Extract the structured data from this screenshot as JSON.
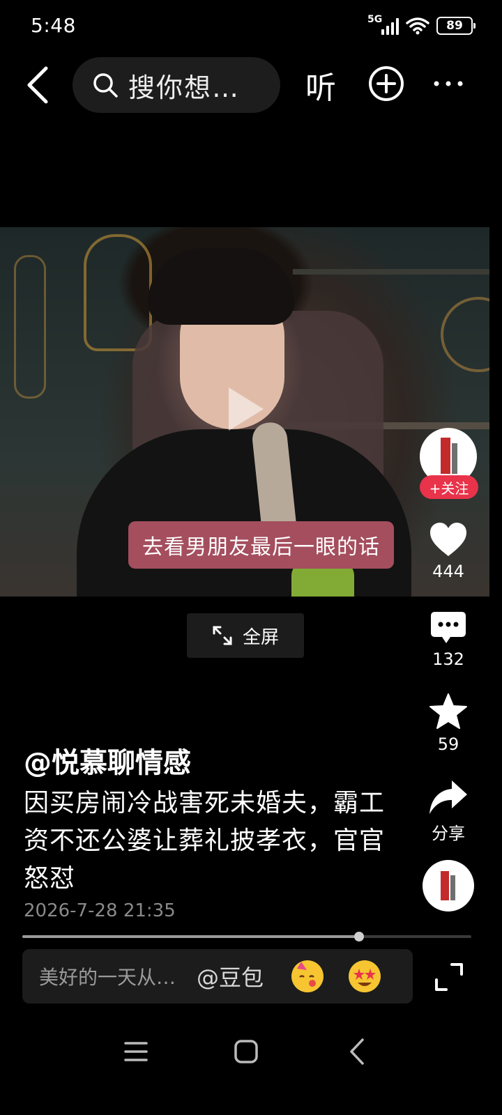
{
  "status_bar": {
    "time": "5:48",
    "network": "5G",
    "battery": "89"
  },
  "header": {
    "search_placeholder": "搜你想…",
    "listen_label": "听"
  },
  "video": {
    "subtitle": "去看男朋友最后一眼的话"
  },
  "actions": {
    "follow_label": "+关注",
    "likes": "444",
    "comments": "132",
    "favorites": "59",
    "share_label": "分享"
  },
  "fullscreen_label": "全屏",
  "post": {
    "author": "@悦慕聊情感",
    "description": "因买房闹冷战害死未婚夫，霸工资不还公婆让葬礼披孝衣，官官怒怼",
    "date": "2026-7-28 21:35"
  },
  "playback_progress": 0.75,
  "comment_bar": {
    "placeholder": "美好的一天从…",
    "mention": "@豆包"
  },
  "icons": [
    "back-icon",
    "search-icon",
    "add-icon",
    "more-icon",
    "play-icon",
    "heart-icon",
    "comment-icon",
    "star-icon",
    "share-icon",
    "expand-icon",
    "fullscreen-icon",
    "menu-key-icon",
    "home-key-icon",
    "back-key-icon"
  ],
  "colors": {
    "follow_accent": "#e8334a",
    "subtitle_bg": "#a44e5e"
  }
}
